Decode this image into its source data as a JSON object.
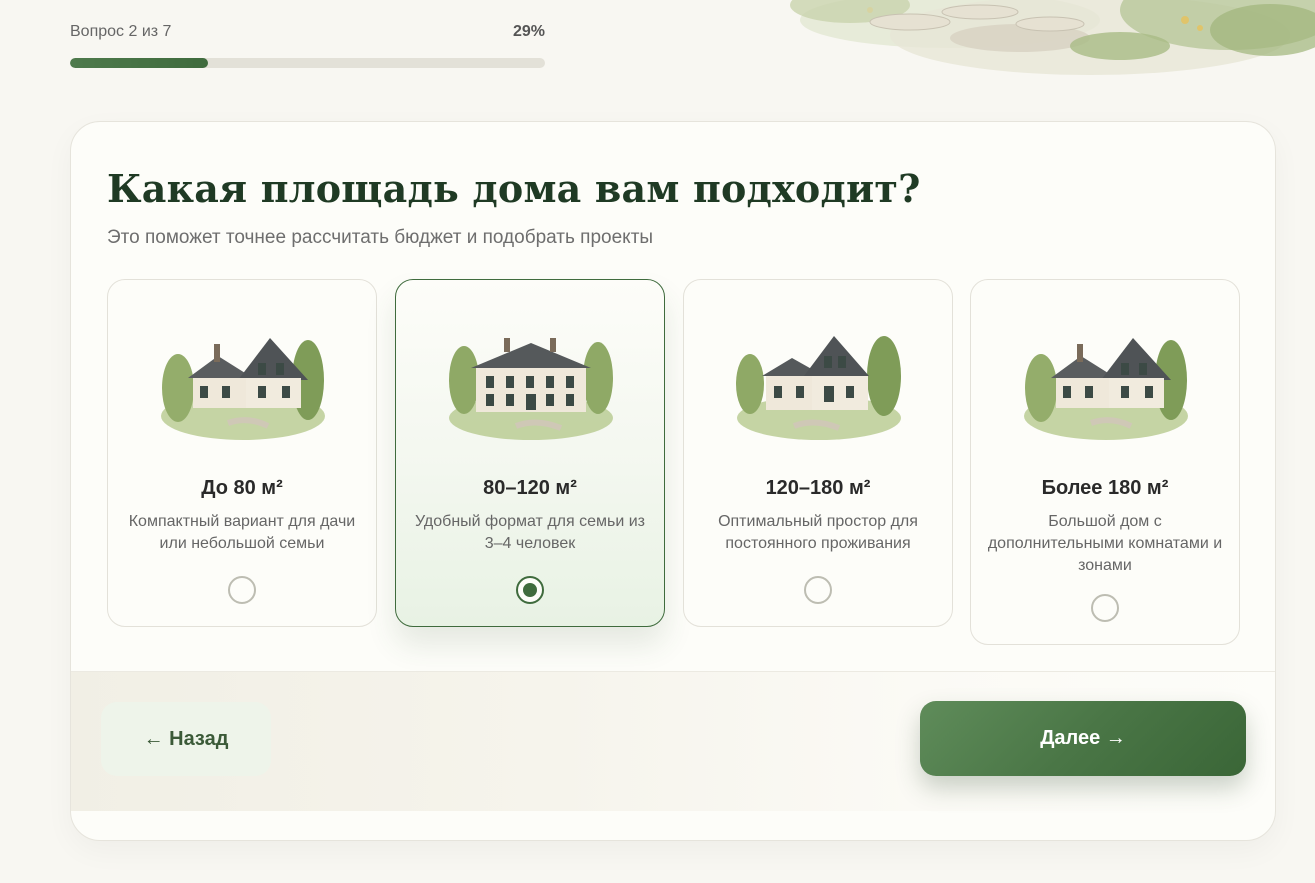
{
  "progress": {
    "label": "Вопрос 2 из 7",
    "percent_text": "29%",
    "fraction": 0.29
  },
  "question": {
    "title": "Какая площадь дома вам подходит?",
    "subtitle": "Это поможет точнее рассчитать бюджет и подобрать проекты"
  },
  "options": [
    {
      "title": "До 80 м²",
      "desc": "Компактный вариант для дачи или небольшой семьи",
      "selected": false
    },
    {
      "title": "80–120 м²",
      "desc": "Удобный формат для семьи из 3–4 человек",
      "selected": true
    },
    {
      "title": "120–180 м²",
      "desc": "Оптимальный простор для постоянного проживания",
      "selected": false
    },
    {
      "title": "Более 180 м²",
      "desc": "Большой дом с дополнительными комнатами и зонами",
      "selected": false
    }
  ],
  "nav": {
    "back_label": "← Назад",
    "next_label": "Далее →"
  },
  "colors": {
    "accent": "#3f6b3d",
    "title": "#1f3a24",
    "background": "#f8f7f2"
  }
}
